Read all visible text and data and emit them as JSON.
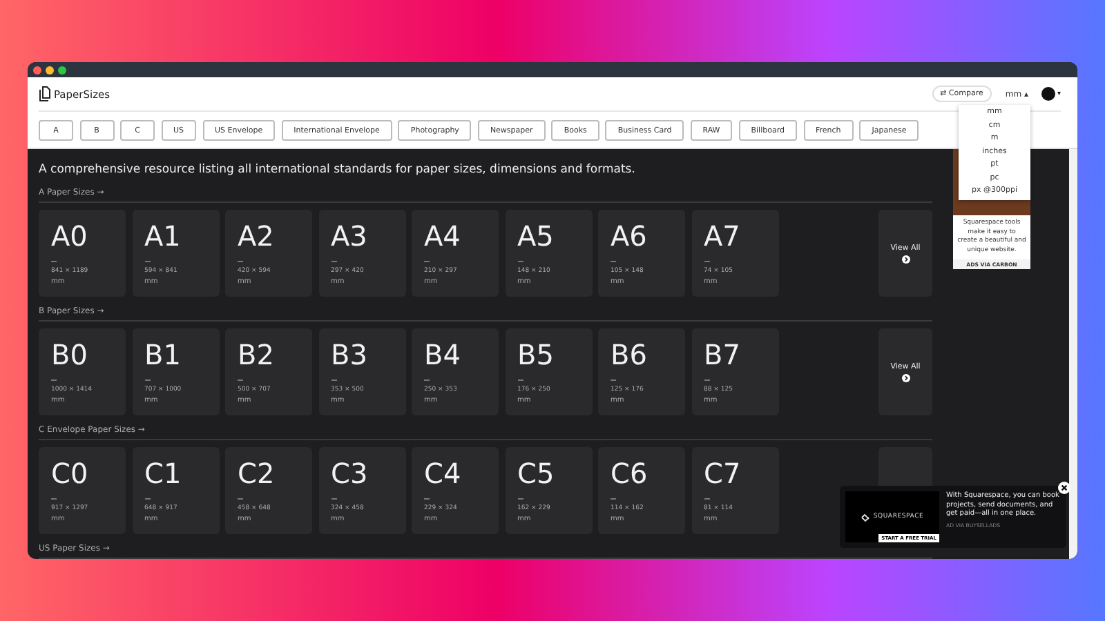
{
  "header": {
    "logo": "PaperSizes",
    "compare": "⇄ Compare",
    "unit": "mm",
    "unit_caret": "▴",
    "account_caret": "▾",
    "unit_menu_expanded": true
  },
  "nav_tabs": [
    "A",
    "B",
    "C",
    "US",
    "US Envelope",
    "International Envelope",
    "Photography",
    "Newspaper",
    "Books",
    "Business Card",
    "RAW",
    "Billboard",
    "French",
    "Japanese"
  ],
  "unit_menu": [
    "mm",
    "cm",
    "m",
    "inches",
    "pt",
    "pc",
    "px @300ppi"
  ],
  "description": "A comprehensive resource listing all international standards for paper sizes, dimensions and formats.",
  "sections": [
    {
      "heading": "A Paper Sizes →",
      "view_all": "View All",
      "cards": [
        {
          "name": "A0",
          "dims": "841 × 1189",
          "unit": "mm"
        },
        {
          "name": "A1",
          "dims": "594 × 841",
          "unit": "mm"
        },
        {
          "name": "A2",
          "dims": "420 × 594",
          "unit": "mm"
        },
        {
          "name": "A3",
          "dims": "297 × 420",
          "unit": "mm"
        },
        {
          "name": "A4",
          "dims": "210 × 297",
          "unit": "mm"
        },
        {
          "name": "A5",
          "dims": "148 × 210",
          "unit": "mm"
        },
        {
          "name": "A6",
          "dims": "105 × 148",
          "unit": "mm"
        },
        {
          "name": "A7",
          "dims": "74 × 105",
          "unit": "mm"
        }
      ]
    },
    {
      "heading": "B Paper Sizes →",
      "view_all": "View All",
      "cards": [
        {
          "name": "B0",
          "dims": "1000 × 1414",
          "unit": "mm"
        },
        {
          "name": "B1",
          "dims": "707 × 1000",
          "unit": "mm"
        },
        {
          "name": "B2",
          "dims": "500 × 707",
          "unit": "mm"
        },
        {
          "name": "B3",
          "dims": "353 × 500",
          "unit": "mm"
        },
        {
          "name": "B4",
          "dims": "250 × 353",
          "unit": "mm"
        },
        {
          "name": "B5",
          "dims": "176 × 250",
          "unit": "mm"
        },
        {
          "name": "B6",
          "dims": "125 × 176",
          "unit": "mm"
        },
        {
          "name": "B7",
          "dims": "88 × 125",
          "unit": "mm"
        }
      ]
    },
    {
      "heading": "C Envelope Paper Sizes →",
      "cards": [
        {
          "name": "C0",
          "dims": "917 × 1297",
          "unit": "mm"
        },
        {
          "name": "C1",
          "dims": "648 × 917",
          "unit": "mm"
        },
        {
          "name": "C2",
          "dims": "458 × 648",
          "unit": "mm"
        },
        {
          "name": "C3",
          "dims": "324 × 458",
          "unit": "mm"
        },
        {
          "name": "C4",
          "dims": "229 × 324",
          "unit": "mm"
        },
        {
          "name": "C5",
          "dims": "162 × 229",
          "unit": "mm"
        },
        {
          "name": "C6",
          "dims": "114 × 162",
          "unit": "mm"
        },
        {
          "name": "C7",
          "dims": "81 × 114",
          "unit": "mm"
        }
      ]
    },
    {
      "heading": "US Paper Sizes →"
    }
  ],
  "side_ad": {
    "text": "Squarespace tools make it easy to create a beautiful and unique website.",
    "footer": "ADS VIA CARBON"
  },
  "popup_ad": {
    "brand": "SQUARESPACE",
    "cta": "START A FREE TRIAL",
    "text": "With Squarespace, you can book projects, send documents, and get paid—all in one place.",
    "footer": "AD VIA BUYSELLADS"
  }
}
